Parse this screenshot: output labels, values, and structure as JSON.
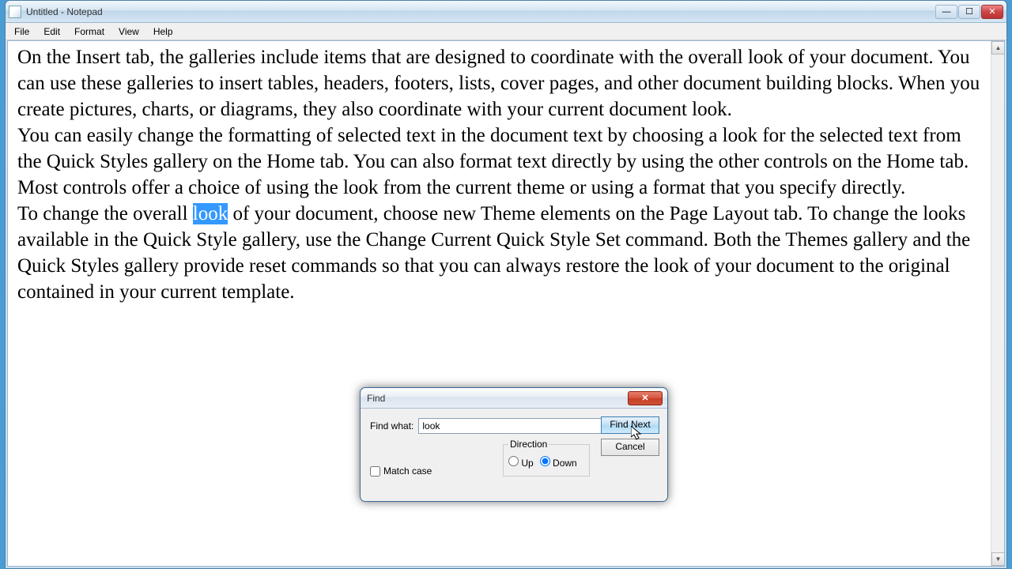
{
  "window": {
    "title": "Untitled - Notepad"
  },
  "menu": {
    "file": "File",
    "edit": "Edit",
    "format": "Format",
    "view": "View",
    "help": "Help"
  },
  "document": {
    "part1": "On the Insert tab, the galleries include items that are designed to coordinate with the overall look of your document. You can use these galleries to insert tables, headers, footers, lists, cover pages, and other document building blocks. When you create pictures, charts, or diagrams, they also coordinate with your current document look.",
    "part2": "You can easily change the formatting of selected text in the document text by choosing a look for the selected text from the Quick Styles gallery on the Home tab. You can also format text directly by using the other controls on the Home tab. Most controls offer a choice of using the look from the current theme or using a format that you specify directly.",
    "part3a": "To change the overall ",
    "highlight": "look",
    "part3b": " of your document, choose new Theme elements on the Page Layout tab. To change the looks available in the Quick Style gallery, use the Change Current Quick Style Set command. Both the Themes gallery and the Quick Styles gallery provide reset commands so that you can always restore the look of your document to the original contained in your current template."
  },
  "dialog": {
    "title": "Find",
    "find_what_label": "Find what:",
    "find_what_value": "look",
    "find_next": "Find Next",
    "cancel": "Cancel",
    "direction_label": "Direction",
    "up": "Up",
    "down": "Down",
    "direction_selected": "down",
    "match_case": "Match case",
    "match_case_checked": false
  }
}
